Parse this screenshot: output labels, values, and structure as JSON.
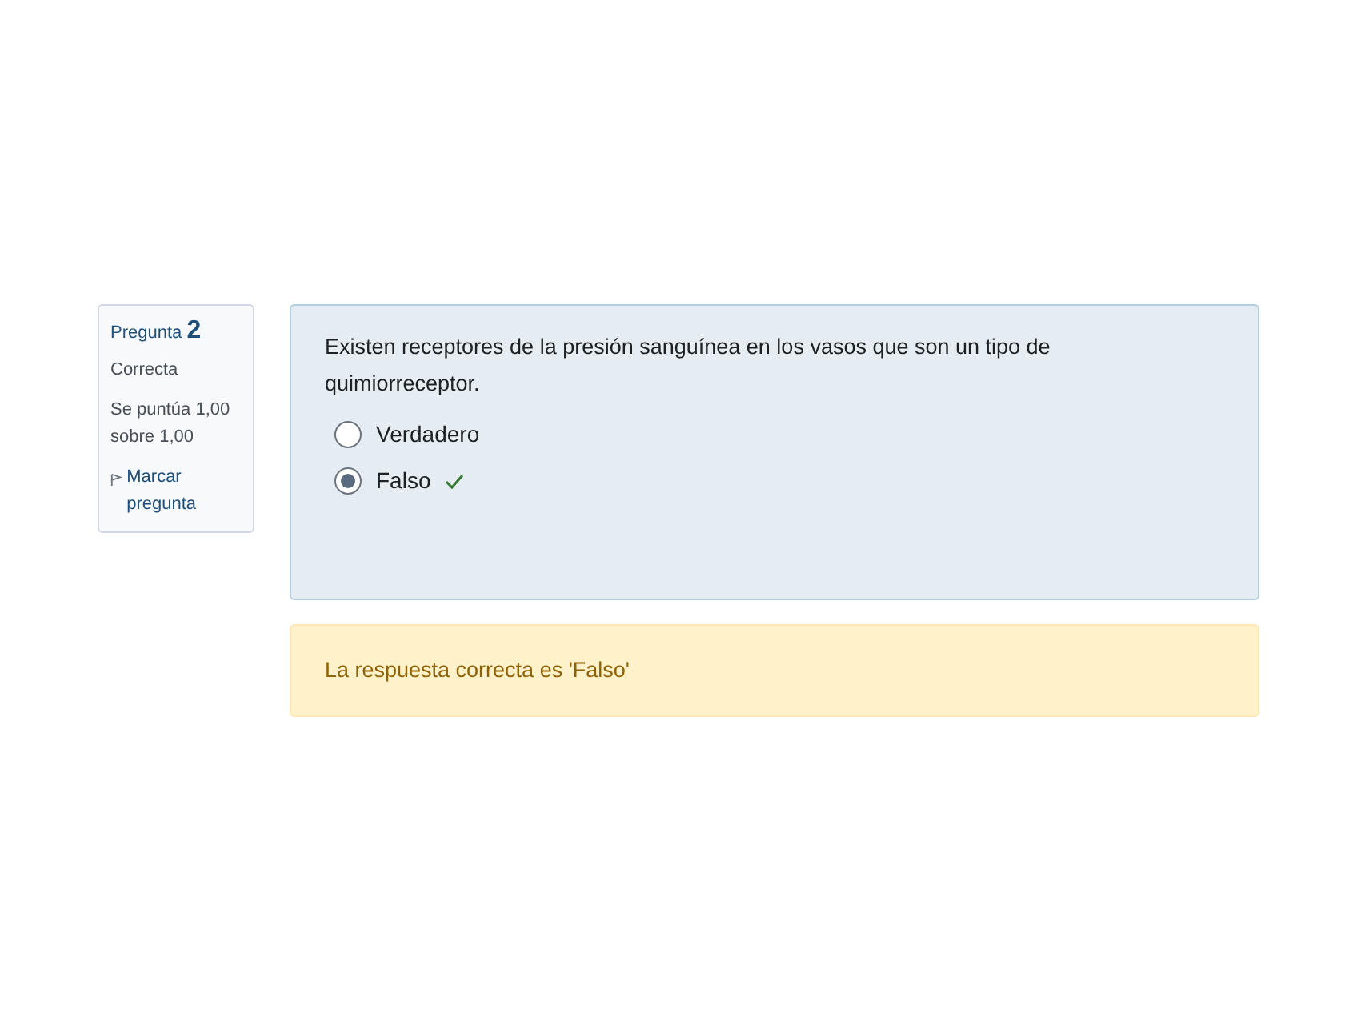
{
  "info": {
    "label": "Pregunta",
    "number": "2",
    "state": "Correcta",
    "grade": "Se puntúa 1,00 sobre 1,00",
    "flag": "Marcar pregunta"
  },
  "question": {
    "text": "Existen receptores de la presión sanguínea en los vasos que son un tipo de quimiorreceptor.",
    "options": [
      {
        "label": "Verdadero",
        "selected": false,
        "correct": false
      },
      {
        "label": "Falso",
        "selected": true,
        "correct": true
      }
    ]
  },
  "feedback": {
    "text": "La respuesta correcta es 'Falso'"
  }
}
